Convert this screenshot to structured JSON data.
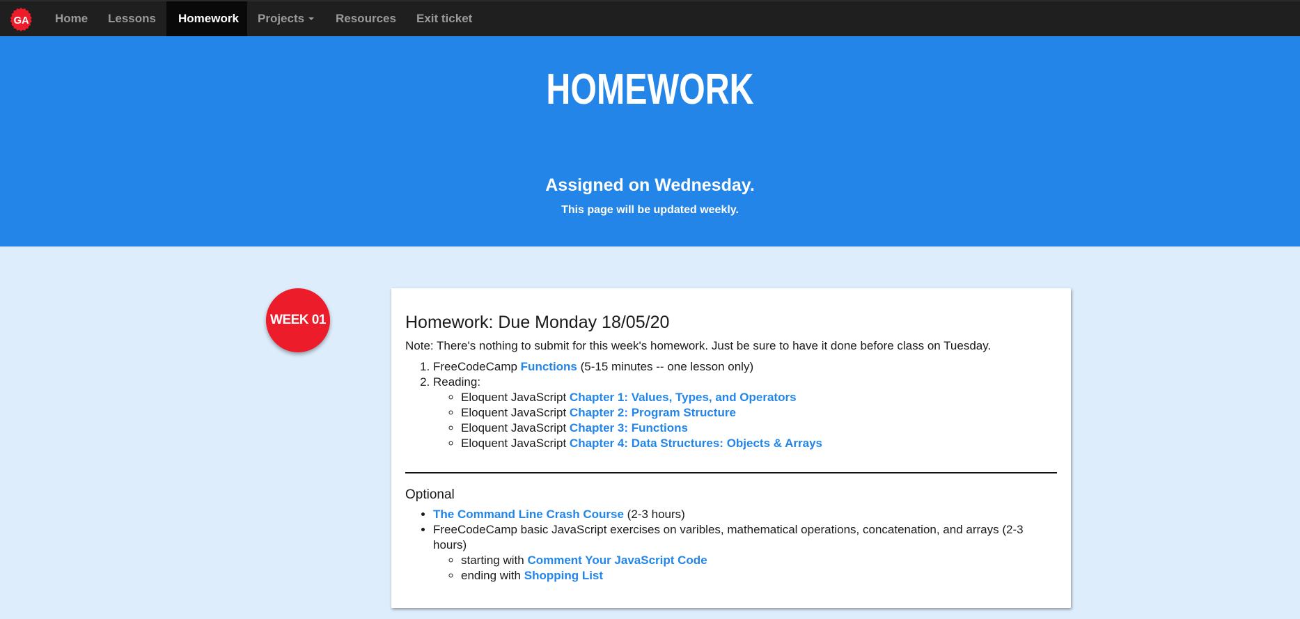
{
  "navbar": {
    "logo_text": "GA",
    "items": [
      {
        "label": "Home",
        "active": false
      },
      {
        "label": "Lessons",
        "active": false
      },
      {
        "label": "Homework",
        "active": true
      },
      {
        "label": "Projects",
        "active": false,
        "dropdown": true
      },
      {
        "label": "Resources",
        "active": false
      },
      {
        "label": "Exit ticket",
        "active": false
      }
    ]
  },
  "hero": {
    "title": "HOMEWORK",
    "assigned": "Assigned on Wednesday.",
    "subtitle": "This page will be updated weekly."
  },
  "week": {
    "badge": "WEEK 01",
    "card": {
      "title": "Homework: Due Monday 18/05/20",
      "note": "Note: There's nothing to submit for this week's homework. Just be sure to have it done before class on Tuesday.",
      "items": [
        {
          "prefix": "FreeCodeCamp ",
          "link": "Functions",
          "suffix": " (5-15 minutes -- one lesson only)"
        },
        {
          "prefix": "Reading:",
          "subitems": [
            {
              "prefix": "Eloquent JavaScript ",
              "link": "Chapter 1: Values, Types, and Operators"
            },
            {
              "prefix": "Eloquent JavaScript ",
              "link": "Chapter 2: Program Structure"
            },
            {
              "prefix": "Eloquent JavaScript ",
              "link": "Chapter 3: Functions"
            },
            {
              "prefix": "Eloquent JavaScript ",
              "link": "Chapter 4: Data Structures: Objects & Arrays"
            }
          ]
        }
      ],
      "optional": {
        "title": "Optional",
        "items": [
          {
            "link": "The Command Line Crash Course",
            "suffix": " (2-3 hours)"
          },
          {
            "text": "FreeCodeCamp basic JavaScript exercises on varibles, mathematical operations, concatenation, and arrays (2-3 hours)",
            "subitems": [
              {
                "prefix": "starting with ",
                "link": "Comment Your JavaScript Code"
              },
              {
                "prefix": "ending with ",
                "link": "Shopping List"
              }
            ]
          }
        ]
      }
    }
  },
  "colors": {
    "accent_blue": "#2385E8",
    "badge_red": "#EC1C2B",
    "nav_bg": "#1f1f1f",
    "page_bg": "#DDEDFC"
  }
}
